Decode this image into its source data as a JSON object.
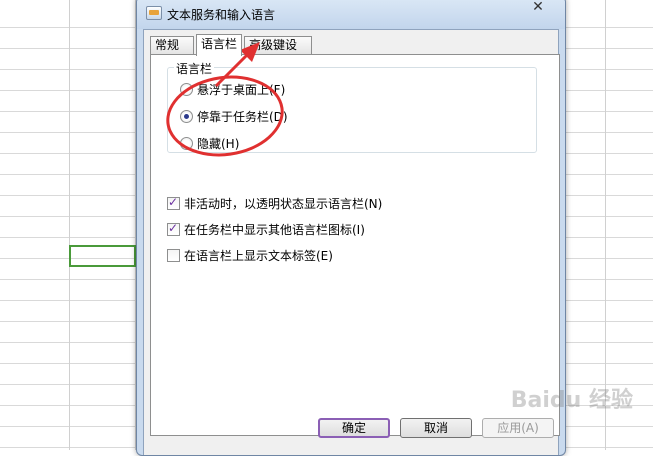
{
  "dialog": {
    "title": "文本服务和输入语言",
    "close_glyph": "✕"
  },
  "tabs": [
    {
      "label": "常规"
    },
    {
      "label": "语言栏"
    },
    {
      "label": "高级键设置"
    }
  ],
  "language_bar": {
    "group_title": "语言栏",
    "radios": [
      {
        "label": "悬浮于桌面上(F)",
        "checked": false
      },
      {
        "label": "停靠于任务栏(D)",
        "checked": true
      },
      {
        "label": "隐藏(H)",
        "checked": false
      }
    ],
    "checkboxes": [
      {
        "label": "非活动时，以透明状态显示语言栏(N)",
        "checked": true
      },
      {
        "label": "在任务栏中显示其他语言栏图标(I)",
        "checked": true
      },
      {
        "label": "在语言栏上显示文本标签(E)",
        "checked": false
      }
    ]
  },
  "buttons": {
    "ok": "确定",
    "cancel": "取消",
    "apply": "应用(A)"
  },
  "watermark": "Baidu 经验",
  "colors": {
    "annotation": "#e03030",
    "active_cell_border": "#4a9a3a"
  }
}
